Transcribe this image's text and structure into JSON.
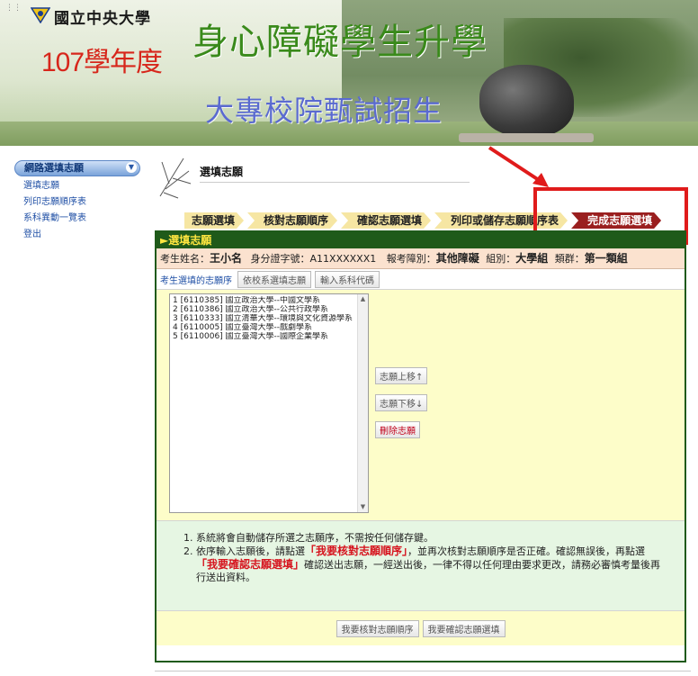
{
  "banner": {
    "university": "國立中央大學",
    "year": "107學年度",
    "title_main": "身心障礙學生升學",
    "title_sub": "大專校院甄試招生"
  },
  "sidebar": {
    "header": "網路選填志願",
    "items": [
      {
        "label": "選填志願"
      },
      {
        "label": "列印志願順序表"
      },
      {
        "label": "系科異動一覽表"
      },
      {
        "label": "登出"
      }
    ]
  },
  "content": {
    "section_title": "選填志願"
  },
  "steps": [
    {
      "label": "志願選填"
    },
    {
      "label": "核對志願順序"
    },
    {
      "label": "確認志願選填"
    },
    {
      "label": "列印或儲存志願順序表"
    },
    {
      "label": "完成志願選填"
    }
  ],
  "panel": {
    "header": "►選填志願",
    "info": {
      "name_label": "考生姓名：",
      "name": "王小名",
      "id_label": "身分證字號：",
      "id": "A11XXXXXX1",
      "category_label": "報考障別：",
      "category": "其他障礙",
      "group_label": "組別：",
      "group": "大學組",
      "cluster_label": "類群：",
      "cluster": "第一類組"
    },
    "tabs": {
      "label": "考生選填的志願序",
      "btn_by_school": "依校系選填志願",
      "btn_enter_code": "輸入系科代碼"
    },
    "choices": [
      "1 [6110385] 國立政治大學--中國文學系",
      "2 [6110386] 國立政治大學--公共行政學系",
      "3 [6110333] 國立清華大學--環境與文化資源學系",
      "4 [6110005] 國立臺灣大學--戲劇學系",
      "5 [6110006] 國立臺灣大學--國際企業學系"
    ],
    "actions": {
      "move_up": "志願上移↑",
      "move_down": "志願下移↓",
      "delete": "刪除志願"
    },
    "notes": {
      "n1": "系統將會自動儲存所選之志願序，不需按任何儲存鍵。",
      "n2_a": "依序輸入志願後，請點選",
      "n2_hl1": "「我要核對志願順序」",
      "n2_b": "，並再次核對志願順序是否正確。確認無誤後，再點選",
      "n2_hl2": "「我要確認志願選填」",
      "n2_c": "確認送出志願，一經送出後，一律不得以任何理由要求更改，請務必審慎考量後再行送出資料。"
    },
    "bottom": {
      "verify": "我要核對志願順序",
      "confirm": "我要確認志願選填"
    }
  },
  "colors": {
    "panel_green": "#1f5a1a",
    "active_step": "#9a1f1f",
    "highlight_red": "#e01b1b"
  }
}
